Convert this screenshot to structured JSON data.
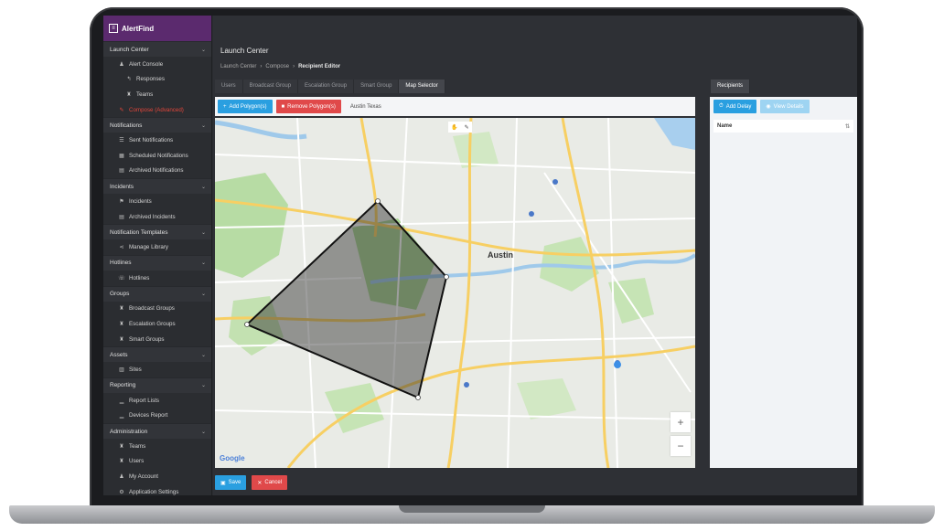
{
  "app": {
    "name": "AlertFind"
  },
  "sidebar": {
    "sections": [
      {
        "label": "Launch Center",
        "items": [
          {
            "label": "Alert Console",
            "icon": "person-icon",
            "sub": false
          },
          {
            "label": "Responses",
            "icon": "reply-icon",
            "sub": true
          },
          {
            "label": "Teams",
            "icon": "team-icon",
            "sub": true
          },
          {
            "label": "Compose (Advanced)",
            "icon": "pencil-icon",
            "sub": false,
            "active": true
          }
        ]
      },
      {
        "label": "Notifications",
        "items": [
          {
            "label": "Sent Notifications",
            "icon": "list-icon"
          },
          {
            "label": "Scheduled Notifications",
            "icon": "calendar-icon"
          },
          {
            "label": "Archived Notifications",
            "icon": "archive-icon"
          }
        ]
      },
      {
        "label": "Incidents",
        "items": [
          {
            "label": "Incidents",
            "icon": "flag-icon"
          },
          {
            "label": "Archived Incidents",
            "icon": "archive-icon"
          }
        ]
      },
      {
        "label": "Notification Templates",
        "items": [
          {
            "label": "Manage Library",
            "icon": "share-icon"
          }
        ]
      },
      {
        "label": "Hotlines",
        "items": [
          {
            "label": "Hotlines",
            "icon": "phone-icon"
          }
        ]
      },
      {
        "label": "Groups",
        "items": [
          {
            "label": "Broadcast Groups",
            "icon": "team-icon"
          },
          {
            "label": "Escalation Groups",
            "icon": "team-icon"
          },
          {
            "label": "Smart Groups",
            "icon": "team-icon"
          }
        ]
      },
      {
        "label": "Assets",
        "items": [
          {
            "label": "Sites",
            "icon": "building-icon"
          }
        ]
      },
      {
        "label": "Reporting",
        "items": [
          {
            "label": "Report Lists",
            "icon": "chart-icon"
          },
          {
            "label": "Devices Report",
            "icon": "chart-icon"
          }
        ]
      },
      {
        "label": "Administration",
        "items": [
          {
            "label": "Teams",
            "icon": "team-icon"
          },
          {
            "label": "Users",
            "icon": "team-icon"
          },
          {
            "label": "My Account",
            "icon": "person-icon"
          },
          {
            "label": "Application Settings",
            "icon": "gear-icon"
          }
        ]
      }
    ]
  },
  "header": {
    "title": "Launch Center",
    "breadcrumb": [
      "Launch Center",
      "Compose",
      "Recipient Editor"
    ]
  },
  "tabs": [
    "Users",
    "Broadcast Group",
    "Escalation Group",
    "Smart Group",
    "Map Selector"
  ],
  "active_tab": "Map Selector",
  "right_tab": "Recipients",
  "toolbar": {
    "add_polygon": "Add Polygon(s)",
    "remove_polygon": "Remove Polygon(s)",
    "location": "Austin Texas"
  },
  "right_panel": {
    "add_button": "Add Delay",
    "details_button": "View Details",
    "column_name": "Name"
  },
  "map": {
    "city_label": "Austin",
    "attribution": "Google",
    "zoom_in": "+",
    "zoom_out": "−"
  },
  "footer": {
    "save": "Save",
    "cancel": "Cancel"
  },
  "colors": {
    "brand": "#5b2a6e",
    "primary": "#2a9fe0",
    "danger": "#e0494a",
    "active_nav": "#e2463b"
  }
}
